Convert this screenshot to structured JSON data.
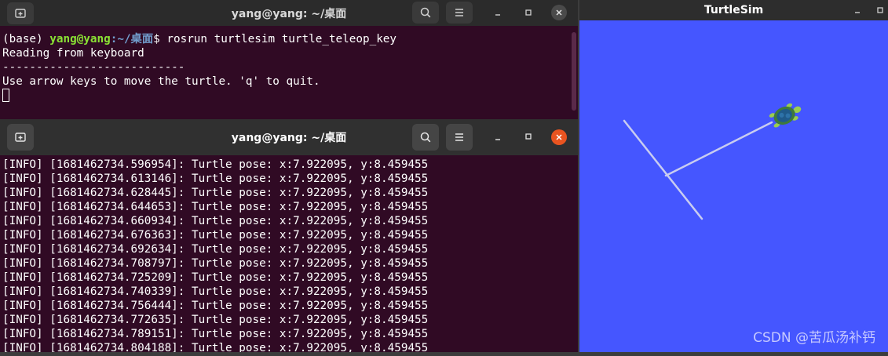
{
  "term1": {
    "title": "yang@yang: ~/桌面",
    "prompt_env": "(base) ",
    "prompt_user": "yang@yang",
    "prompt_path": ":~/桌面",
    "prompt_cmd": "$ rosrun turtlesim turtle_teleop_key",
    "lines": [
      "Reading from keyboard",
      "---------------------------",
      "Use arrow keys to move the turtle. 'q' to quit."
    ]
  },
  "term2": {
    "title": "yang@yang: ~/桌面",
    "lines": [
      "[INFO] [1681462734.596954]: Turtle pose: x:7.922095, y:8.459455",
      "[INFO] [1681462734.613146]: Turtle pose: x:7.922095, y:8.459455",
      "[INFO] [1681462734.628445]: Turtle pose: x:7.922095, y:8.459455",
      "[INFO] [1681462734.644653]: Turtle pose: x:7.922095, y:8.459455",
      "[INFO] [1681462734.660934]: Turtle pose: x:7.922095, y:8.459455",
      "[INFO] [1681462734.676363]: Turtle pose: x:7.922095, y:8.459455",
      "[INFO] [1681462734.692634]: Turtle pose: x:7.922095, y:8.459455",
      "[INFO] [1681462734.708797]: Turtle pose: x:7.922095, y:8.459455",
      "[INFO] [1681462734.725209]: Turtle pose: x:7.922095, y:8.459455",
      "[INFO] [1681462734.740339]: Turtle pose: x:7.922095, y:8.459455",
      "[INFO] [1681462734.756444]: Turtle pose: x:7.922095, y:8.459455",
      "[INFO] [1681462734.772635]: Turtle pose: x:7.922095, y:8.459455",
      "[INFO] [1681462734.789151]: Turtle pose: x:7.922095, y:8.459455",
      "[INFO] [1681462734.804188]: Turtle pose: x:7.922095, y:8.459455"
    ]
  },
  "turtlesim": {
    "title": "TurtleSim",
    "background_color": "#4556ff",
    "watermark": "CSDN @苦瓜汤补钙"
  },
  "icons": {
    "new_tab": "new-tab-icon",
    "search": "search-icon",
    "menu": "hamburger-menu-icon",
    "minimize": "minimize-icon",
    "maximize": "maximize-icon",
    "close": "close-icon"
  },
  "colors": {
    "terminal_bg": "#300a24",
    "prompt_user": "#8ae234",
    "prompt_path": "#729fcf",
    "close_active": "#e95420"
  }
}
